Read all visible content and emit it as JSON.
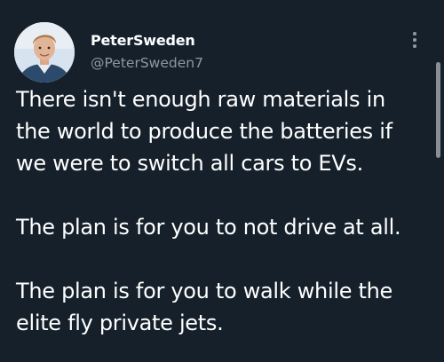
{
  "author": {
    "display_name": "PeterSweden",
    "handle": "@PeterSweden7",
    "avatar_icon": "user-avatar-photo"
  },
  "menu": {
    "more_icon": "more-vertical-icon"
  },
  "tweet": {
    "paragraphs": [
      "There isn't enough raw materials in\nthe world to produce the batteries if\nwe were to switch all cars to EVs.",
      "The plan is for you to not drive at all.",
      "The plan is for you to walk while the\nelite fly private jets."
    ]
  },
  "colors": {
    "background": "#15202b",
    "text_primary": "#ffffff",
    "text_secondary": "#8b98a5"
  }
}
